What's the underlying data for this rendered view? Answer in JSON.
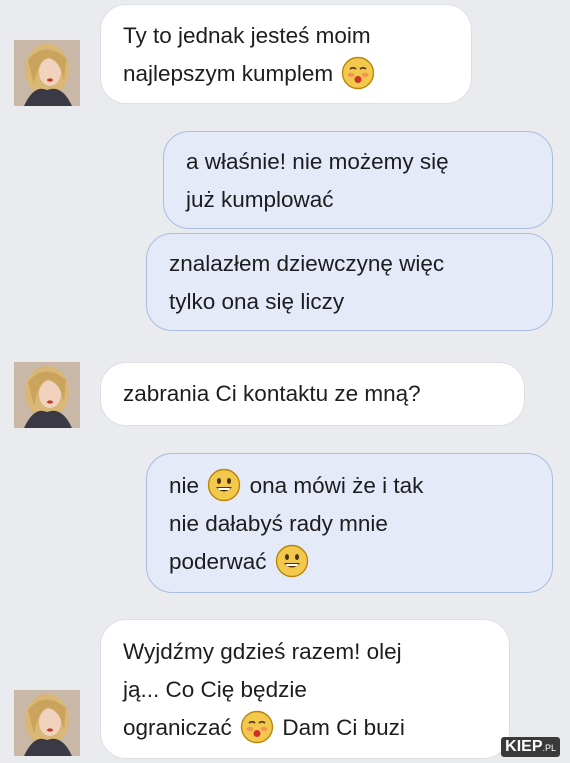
{
  "messages": [
    {
      "sender": "friend",
      "lines": [
        "Ty to jednak jesteś moim",
        "najlepszym kumplem"
      ],
      "emoji_end": "blush-face-icon"
    },
    {
      "sender": "me",
      "lines": [
        "a właśnie! nie możemy się",
        "już kumplować"
      ]
    },
    {
      "sender": "me",
      "lines": [
        "znalazłem dziewczynę więc",
        "tylko ona się liczy"
      ]
    },
    {
      "sender": "friend",
      "lines": [
        "zabrania Ci kontaktu ze mną?"
      ]
    },
    {
      "sender": "me",
      "line1_a": "nie",
      "line1_b": "ona mówi że i tak",
      "line2": "nie dałabyś rady mnie",
      "line3": "poderwać"
    },
    {
      "sender": "friend",
      "line1": "Wyjdźmy gdzieś razem! olej",
      "line2": "ją... Co Cię będzie",
      "line3_a": "ograniczać",
      "line3_b": "Dam Ci buzi"
    }
  ],
  "watermark": {
    "main": "KIEP",
    "suffix": ".PL"
  },
  "colors": {
    "background": "#e9ebee",
    "incoming_bubble": "#ffffff",
    "outgoing_bubble": "#e4eaf7",
    "outgoing_border": "#a9bde0"
  }
}
